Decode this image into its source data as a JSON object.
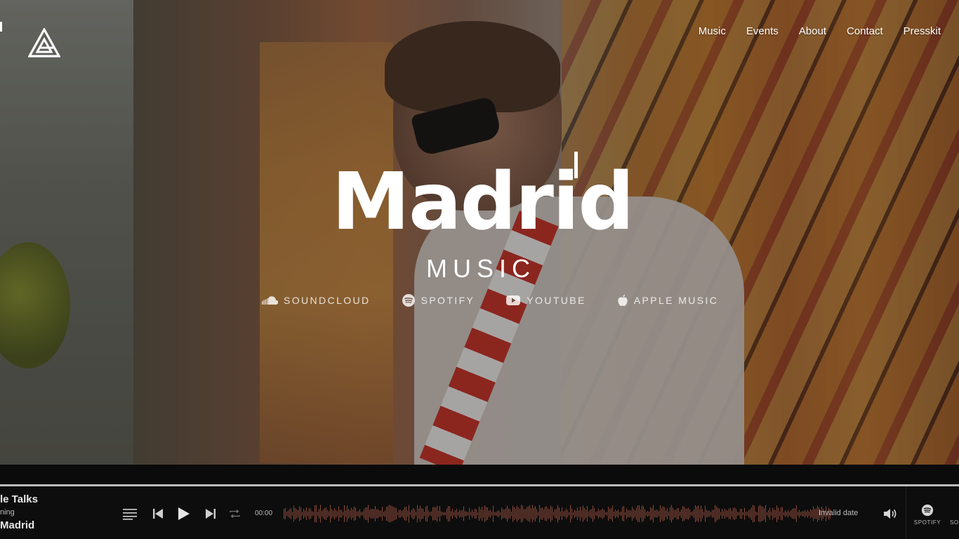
{
  "nav": {
    "items": [
      "Music",
      "Events",
      "About",
      "Contact",
      "Presskit"
    ]
  },
  "hero": {
    "title": "Madrid",
    "subtitle": "MUSIC"
  },
  "platforms": [
    {
      "label": "SOUNDCLOUD",
      "icon": "soundcloud-icon"
    },
    {
      "label": "SPOTIFY",
      "icon": "spotify-icon"
    },
    {
      "label": "YOUTUBE",
      "icon": "youtube-icon"
    },
    {
      "label": "APPLE MUSIC",
      "icon": "apple-icon"
    }
  ],
  "player": {
    "track_title": "le Talks",
    "track_status": "ning",
    "track_artist": "Madrid",
    "current_time": "00:00",
    "duration_text": "Invalid date",
    "external": [
      {
        "label": "SPOTIFY",
        "icon": "spotify-icon"
      },
      {
        "label": "SO",
        "icon": "soundcloud-icon"
      }
    ]
  },
  "colors": {
    "accent_text": "#ffffff",
    "player_bg": "#0d0d0d",
    "waveform": "#8a4a3a"
  }
}
